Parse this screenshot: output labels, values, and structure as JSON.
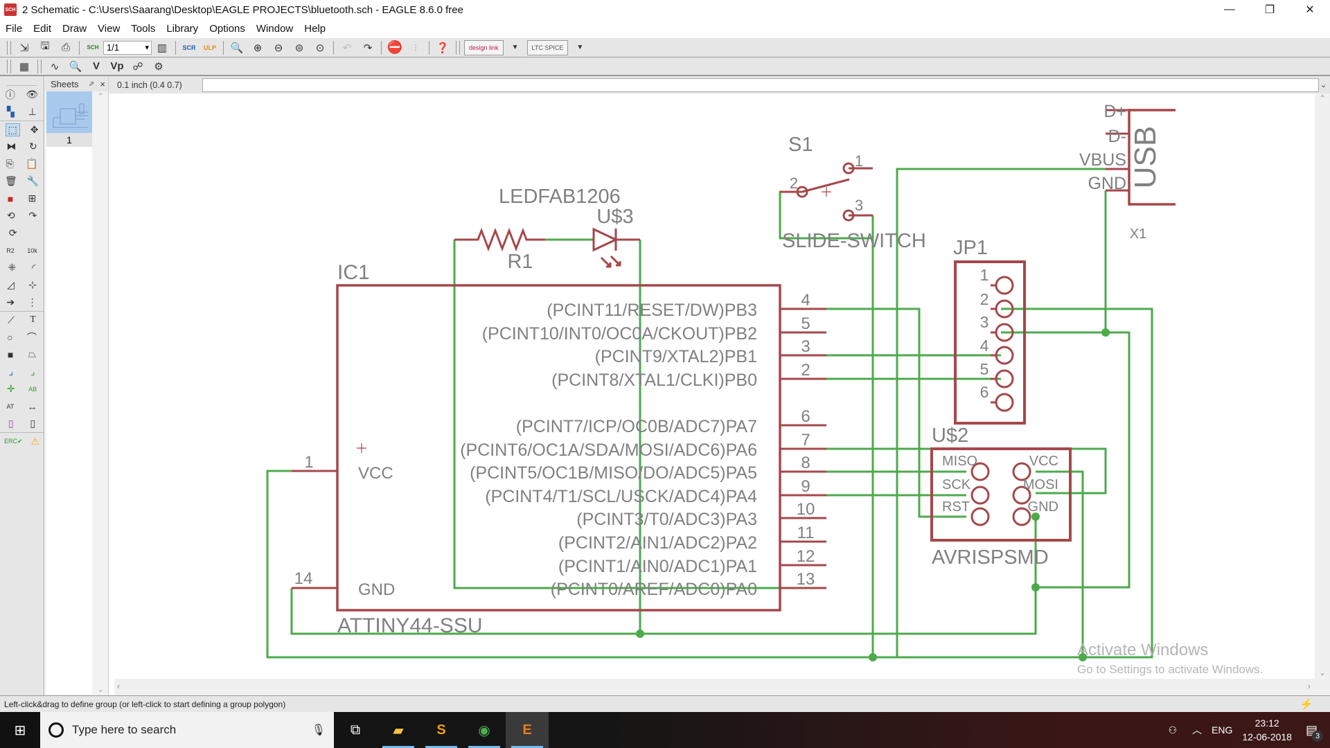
{
  "window": {
    "app_icon": "SCH",
    "title": "2 Schematic - C:\\Users\\Saarang\\Desktop\\EAGLE PROJECTS\\bluetooth.sch - EAGLE 8.6.0 free",
    "controls": {
      "minimize": "—",
      "maximize": "❐",
      "close": "✕"
    }
  },
  "menu": [
    "File",
    "Edit",
    "Draw",
    "View",
    "Tools",
    "Library",
    "Options",
    "Window",
    "Help"
  ],
  "toolbar1": {
    "icons": [
      "open-icon",
      "save-icon",
      "print-icon",
      "sch-brd-switch-icon"
    ],
    "sheet_select": "1/1",
    "icons2": [
      "layers-icon",
      "script-icon",
      "ulp-icon",
      "zoom-fit-icon",
      "zoom-in-icon",
      "zoom-out-icon",
      "zoom-select-icon",
      "zoom-redraw-icon",
      "undo-icon",
      "redo-icon",
      "stop-icon",
      "go-icon",
      "help-icon"
    ],
    "design_link": "design link",
    "ltspice": "LTC SPICE"
  },
  "toolbar2": {
    "icons": [
      "grid-icon",
      "net-classes-icon",
      "highlight-icon",
      "value-icon",
      "vp-icon",
      "pinswap-icon",
      "settings-icon"
    ]
  },
  "left_tools": [
    [
      "info-icon",
      "eye-icon"
    ],
    [
      "layer-icon",
      "mark-icon"
    ],
    [
      "group-select-icon",
      "move-icon"
    ],
    [
      "mirror-icon",
      "rotate-icon"
    ],
    [
      "copy-icon",
      "paste-icon"
    ],
    [
      "delete-icon",
      "wrench-icon"
    ],
    [
      "add-icon",
      "replace-icon"
    ],
    [
      "gate-swap-icon",
      "invoke-icon"
    ],
    [
      "pin-swap-icon",
      ""
    ],
    [
      "name-icon",
      "value-label-icon"
    ],
    [
      "smash-icon",
      "miter-icon"
    ],
    [
      "split-icon",
      "optimize-icon"
    ],
    [
      "route-icon",
      "rip-icon"
    ],
    [
      "line-icon",
      "text-icon"
    ],
    [
      "circle-icon",
      "arc-icon"
    ],
    [
      "rect-icon",
      "polygon-icon"
    ],
    [
      "bus-icon",
      "net-icon"
    ],
    [
      "junction-icon",
      "label-icon"
    ],
    [
      "attribute-icon",
      "dimension-icon"
    ],
    [
      "module-icon",
      "port-icon"
    ],
    [
      "erc-icon",
      "warning-icon"
    ]
  ],
  "sheets": {
    "title": "Sheets",
    "pin": "⬀",
    "close": "×",
    "items": [
      {
        "label": "1"
      }
    ]
  },
  "command": {
    "coordinate": "0.1 inch (0.4 0.7)",
    "value": ""
  },
  "schematic": {
    "colors": {
      "symbol": "#a5474a",
      "net": "#4caa4c",
      "text": "#808080"
    },
    "ic1": {
      "name": "IC1",
      "value": "ATTINY44-SSU",
      "left_pins": [
        {
          "num": "1",
          "label": "VCC"
        },
        {
          "num": "14",
          "label": "GND"
        }
      ],
      "right_pins": [
        {
          "num": "4",
          "label": "(PCINT11/RESET/DW)PB3"
        },
        {
          "num": "5",
          "label": "(PCINT10/INT0/OC0A/CKOUT)PB2"
        },
        {
          "num": "3",
          "label": "(PCINT9/XTAL2)PB1"
        },
        {
          "num": "2",
          "label": "(PCINT8/XTAL1/CLKI)PB0"
        },
        {
          "num": "6",
          "label": "(PCINT7/ICP/OC0B/ADC7)PA7"
        },
        {
          "num": "7",
          "label": "(PCINT6/OC1A/SDA/MOSI/ADC6)PA6"
        },
        {
          "num": "8",
          "label": "(PCINT5/OC1B/MISO/DO/ADC5)PA5"
        },
        {
          "num": "9",
          "label": "(PCINT4/T1/SCL/USCK/ADC4)PA4"
        },
        {
          "num": "10",
          "label": "(PCINT3/T0/ADC3)PA3"
        },
        {
          "num": "11",
          "label": "(PCINT2/AIN1/ADC2)PA2"
        },
        {
          "num": "12",
          "label": "(PCINT1/AIN0/ADC1)PA1"
        },
        {
          "num": "13",
          "label": "(PCINT0/AREF/ADC0)PA0"
        }
      ]
    },
    "r1": {
      "name": "R1"
    },
    "led": {
      "name": "U$3",
      "value": "LEDFAB1206"
    },
    "s1": {
      "name": "S1",
      "value": "SLIDE-SWITCH",
      "pins": [
        "1",
        "2",
        "3"
      ]
    },
    "usb": {
      "name": "X1",
      "value": "USB",
      "pins": [
        "D+",
        "D-",
        "VBUS",
        "GND"
      ]
    },
    "jp1": {
      "name": "JP1",
      "pins": [
        "1",
        "2",
        "3",
        "4",
        "5",
        "6"
      ]
    },
    "u2": {
      "name": "U$2",
      "value": "AVRISPSMD",
      "pins_left": [
        "MISO",
        "SCK",
        "RST"
      ],
      "pins_right": [
        "VCC",
        "MOSI",
        "GND"
      ]
    }
  },
  "status": {
    "message": "Left-click&drag to define group (or left-click to start defining a group polygon)"
  },
  "watermark": {
    "line1": "Activate Windows",
    "line2": "Go to Settings to activate Windows."
  },
  "taskbar": {
    "search_placeholder": "Type here to search",
    "apps": [
      "file-explorer-icon",
      "sublime-text-icon",
      "chrome-icon",
      "eagle-icon"
    ],
    "language": "ENG",
    "time": "23:12",
    "date": "12-06-2018",
    "notifications": "3"
  }
}
